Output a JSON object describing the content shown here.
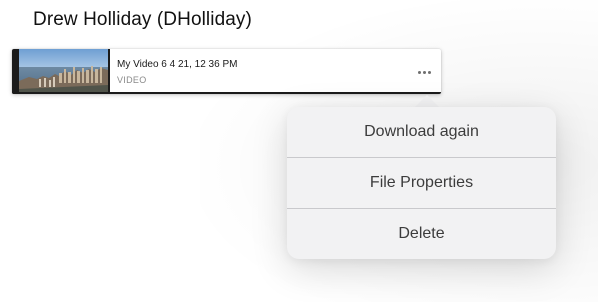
{
  "header": {
    "title": "Drew Holliday (DHolliday)"
  },
  "file": {
    "name": "My Video 6 4 21, 12 36 PM",
    "type": "VIDEO",
    "thumbnail_icon": "city-skyline-thumbnail"
  },
  "actions": {
    "more_icon": "ellipsis-icon"
  },
  "menu": {
    "items": [
      {
        "label": "Download again"
      },
      {
        "label": "File Properties"
      },
      {
        "label": "Delete"
      }
    ]
  }
}
